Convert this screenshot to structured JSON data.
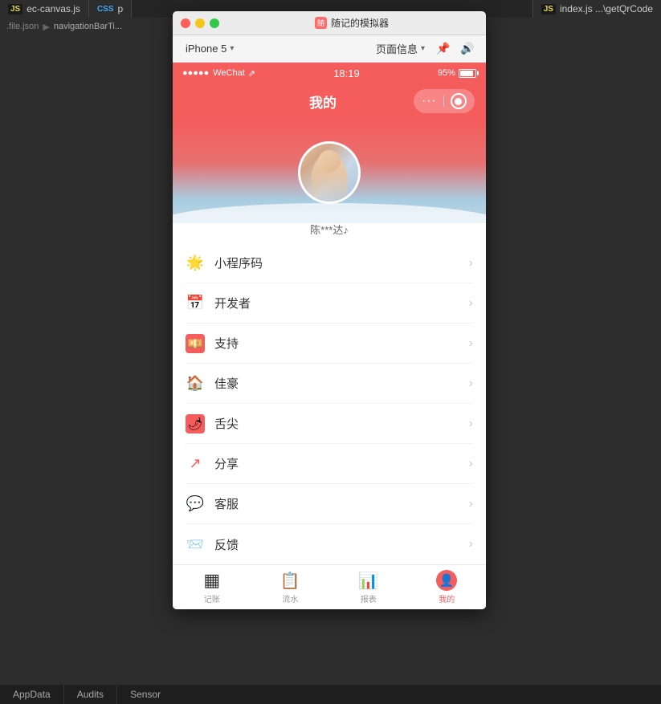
{
  "ide": {
    "tabs": [
      {
        "id": "ec-canvas",
        "icon": "JS",
        "label": "ec-canvas.js"
      },
      {
        "id": "css-tab",
        "icon": "CSS",
        "label": "p"
      },
      {
        "id": "index-js",
        "icon": "JS",
        "label": "index.js ...\\getQrCode"
      }
    ],
    "breadcrumb": {
      "file": ".file.json",
      "separator": "▶",
      "item": "navigationBarTi..."
    },
    "bottomTabs": [
      "AppData",
      "Audits",
      "Sensor"
    ]
  },
  "window": {
    "title": "随记的模拟器",
    "controls": {
      "close": "×",
      "minimize": "−",
      "maximize": "□"
    }
  },
  "simulator": {
    "device": "iPhone 5",
    "pageInfo": "页面信息"
  },
  "statusBar": {
    "signal": "●●●●●",
    "carrier": "WeChat",
    "wifi": "▲",
    "time": "18:19",
    "battery": "95%"
  },
  "navbar": {
    "title": "我的",
    "dots": "···",
    "recordIcon": "⊙"
  },
  "profile": {
    "username": "陈***达♪"
  },
  "menuItems": [
    {
      "id": "miniprogram",
      "icon": "🌟",
      "iconBg": "#fff8e0",
      "label": "小程序码"
    },
    {
      "id": "developer",
      "icon": "📅",
      "iconBg": "#fff0f0",
      "label": "开发者"
    },
    {
      "id": "support",
      "icon": "💴",
      "iconBg": "#fff0f0",
      "label": "支持"
    },
    {
      "id": "jiahao",
      "icon": "🏠",
      "iconBg": "#fff0f0",
      "label": "佳豪"
    },
    {
      "id": "shetip",
      "icon": "🌶",
      "iconBg": "#fff0f0",
      "label": "舌尖"
    },
    {
      "id": "share",
      "icon": "↗",
      "iconBg": "#fff0f5",
      "label": "分享"
    },
    {
      "id": "service",
      "icon": "💬",
      "iconBg": "#f0f8ff",
      "label": "客服"
    },
    {
      "id": "feedback",
      "icon": "📨",
      "iconBg": "#fff8e0",
      "label": "反馈"
    }
  ],
  "tabBar": {
    "items": [
      {
        "id": "account",
        "icon": "▦",
        "label": "记账",
        "active": false
      },
      {
        "id": "flow",
        "icon": "📋",
        "label": "流水",
        "active": false
      },
      {
        "id": "report",
        "icon": "📊",
        "label": "报表",
        "active": false
      },
      {
        "id": "mine",
        "icon": "👤",
        "label": "我的",
        "active": true
      }
    ]
  },
  "colors": {
    "primary": "#f55c5c",
    "tabActive": "#f55c5c",
    "tabInactive": "#333333"
  }
}
